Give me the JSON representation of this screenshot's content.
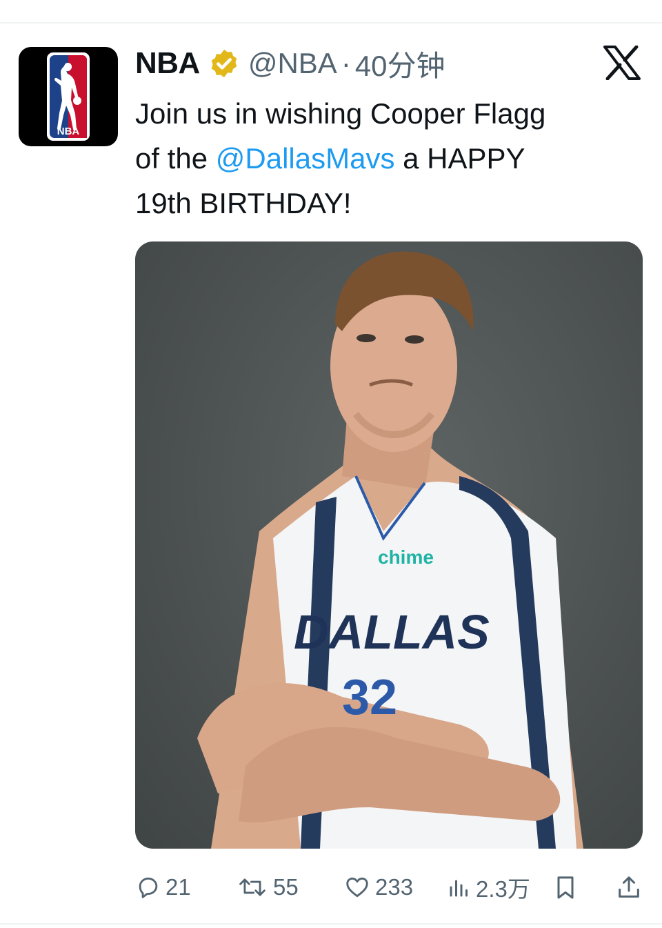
{
  "tweet": {
    "author_name": "NBA",
    "handle": "@NBA",
    "separator": "·",
    "time": "40分钟",
    "text_line1": "Join us in wishing Cooper Flagg",
    "text_pre": "of the ",
    "mention": "@DallasMavs",
    "text_post": " a HAPPY",
    "text_line3": "19th BIRTHDAY!"
  },
  "avatar": {
    "logo_text": "NBA",
    "icon": "nba-logo-icon"
  },
  "media": {
    "jersey_text": "DALLAS",
    "jersey_number": "32",
    "sponsor": "chime",
    "description_icon": "player-photo"
  },
  "actions": {
    "replies": "21",
    "reposts": "55",
    "likes": "233",
    "views": "2.3万"
  },
  "colors": {
    "accent": "#1d9bf0",
    "muted": "#536471",
    "verified_gold": "#e2b719",
    "nba_blue": "#1d428a",
    "nba_red": "#c8102e"
  }
}
